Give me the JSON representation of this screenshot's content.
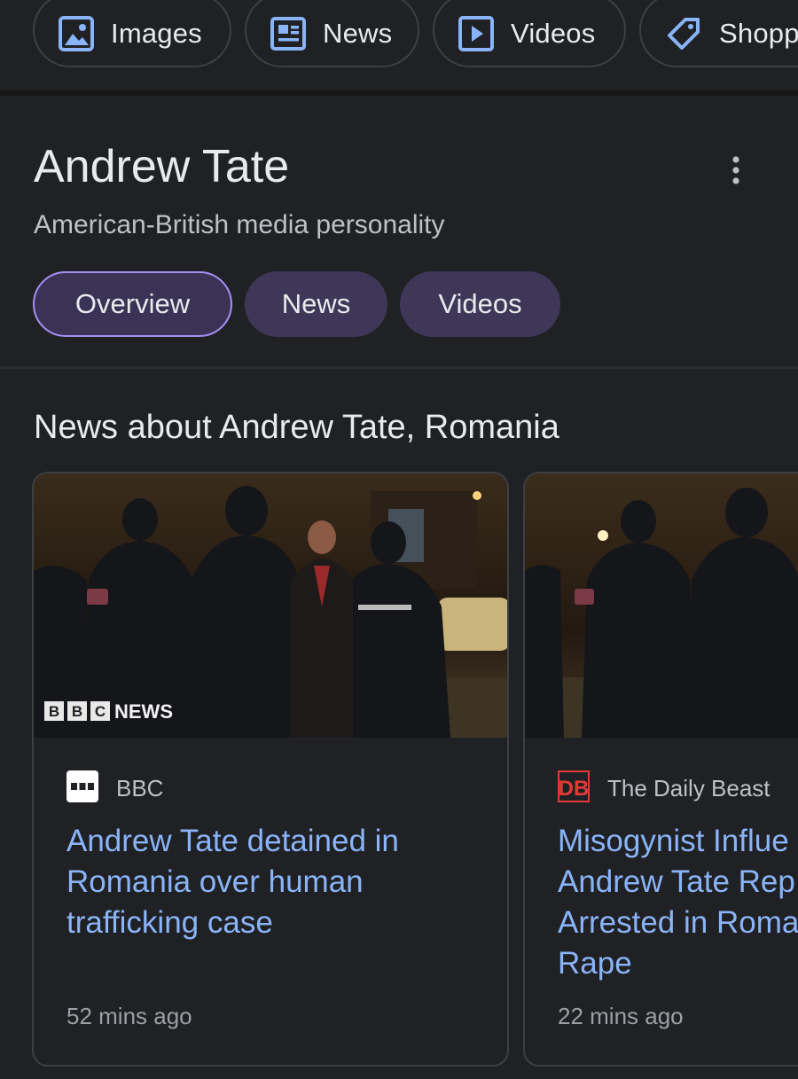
{
  "filter_chips": [
    {
      "label": "Images",
      "icon": "image-icon"
    },
    {
      "label": "News",
      "icon": "news-icon"
    },
    {
      "label": "Videos",
      "icon": "video-icon"
    },
    {
      "label": "Shopp",
      "icon": "tag-icon"
    }
  ],
  "knowledge_panel": {
    "title": "Andrew Tate",
    "subtitle": "American-British media personality",
    "tabs": [
      {
        "label": "Overview",
        "selected": true
      },
      {
        "label": "News",
        "selected": false
      },
      {
        "label": "Videos",
        "selected": false
      }
    ]
  },
  "news_section": {
    "heading": "News about Andrew Tate, Romania",
    "cards": [
      {
        "image_overlay": "BBC NEWS",
        "source": "BBC",
        "headline": "Andrew Tate detained in Romania over human trafficking case",
        "time": "52 mins ago"
      },
      {
        "source": "The Daily Beast",
        "source_logo": "DB",
        "headline": "Misogynist Influe\nAndrew Tate Rep\nArrested in Roma\nRape",
        "time": "22 mins ago"
      }
    ]
  },
  "colors": {
    "background": "#202124",
    "chip_border": "#3c4043",
    "tab_fill": "#3f3758",
    "tab_selected_border": "#a48ff2",
    "link_blue": "#8ab4f8",
    "icon_blue": "#8ab4f8",
    "daily_beast_red": "#e53935"
  }
}
